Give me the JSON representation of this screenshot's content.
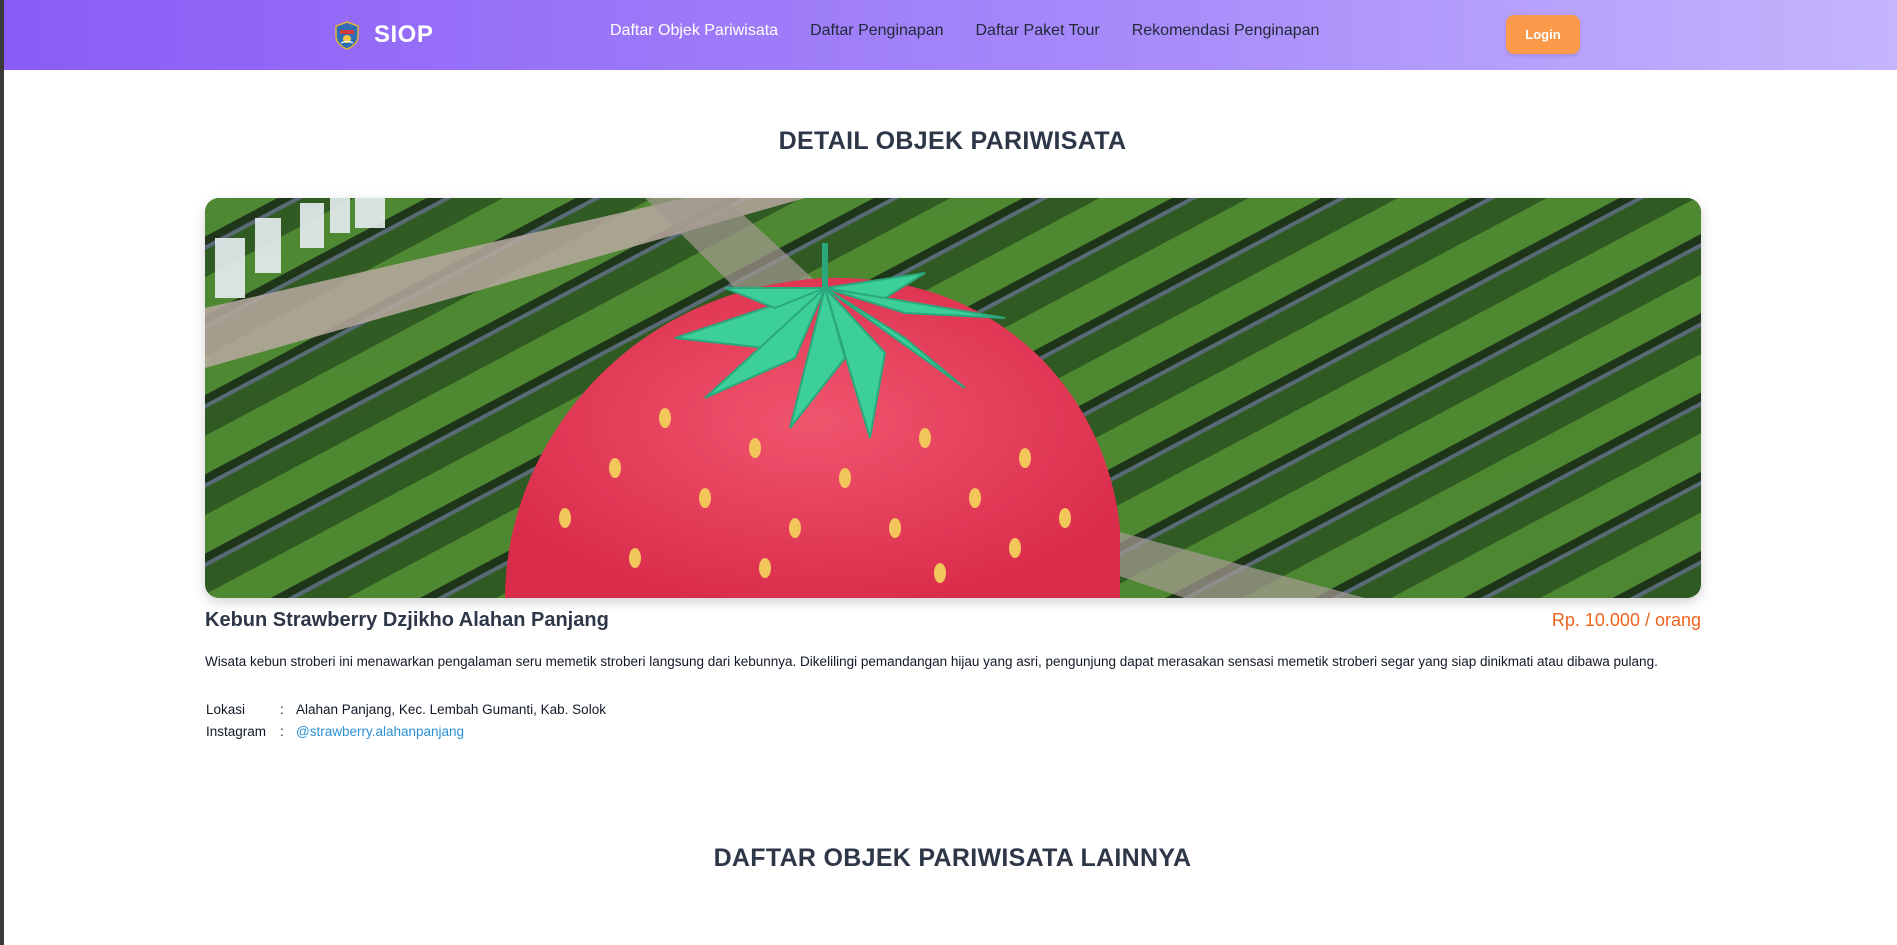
{
  "navbar": {
    "brand": "SIOP",
    "links": [
      {
        "label": "Daftar Objek Pariwisata"
      },
      {
        "label": "Daftar Penginapan"
      },
      {
        "label": "Daftar Paket Tour"
      },
      {
        "label": "Rekomendasi Penginapan"
      }
    ],
    "login_label": "Login",
    "logo_icon": "regional-emblem-icon"
  },
  "detail": {
    "section_title": "DETAIL OBJEK PARIWISATA",
    "name": "Kebun Strawberry Dzjikho Alahan Panjang",
    "price": "Rp. 10.000 / orang",
    "description": "Wisata kebun stroberi ini menawarkan pengalaman seru memetik stroberi langsung dari kebunnya. Dikelilingi pemandangan hijau yang asri, pengunjung dapat merasakan sensasi memetik stroberi segar yang siap dinikmati atau dibawa pulang.",
    "location_label": "Lokasi",
    "location_value": "Alahan Panjang, Kec. Lembah Gumanti, Kab. Solok",
    "instagram_label": "Instagram",
    "instagram_value": "@strawberry.alahanpanjang",
    "separator": ":"
  },
  "others": {
    "section_title": "DAFTAR OBJEK PARIWISATA LAINNYA"
  },
  "colors": {
    "nav_gradient_start": "#8b5cf6",
    "nav_gradient_end": "#c4b5fd",
    "login_bg": "#fb9a4b",
    "price": "#f0631f",
    "link": "#2b8fd6"
  }
}
